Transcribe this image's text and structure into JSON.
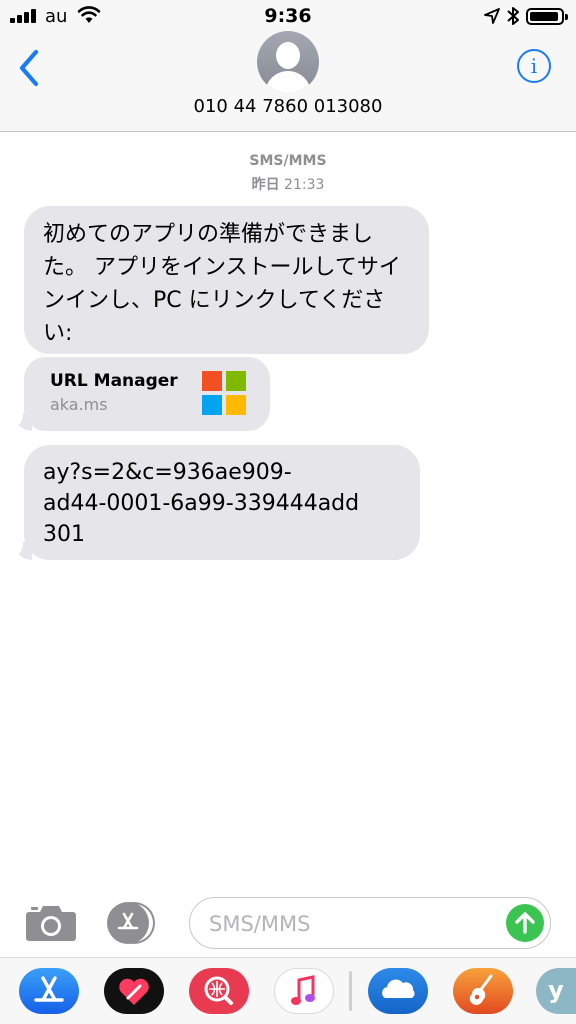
{
  "status_bar": {
    "carrier": "au",
    "time": "9:36"
  },
  "header": {
    "contact_name": "010 44 7860 013080",
    "info_label": "i"
  },
  "conversation": {
    "service": "SMS/MMS",
    "timestamp_day": "昨日",
    "timestamp_time": "21:33",
    "messages": [
      {
        "text": "初めてのアプリの準備ができました。 アプリをインストールしてサインインし、PC にリンクしてください:"
      },
      {
        "text": "ay?s=2&c=936ae909-\nad44-0001-6a99-339444add\n301"
      }
    ],
    "link_preview": {
      "title": "URL Manager",
      "domain": "aka.ms"
    }
  },
  "input_bar": {
    "placeholder": "SMS/MMS"
  },
  "app_drawer": {
    "apps": [
      {
        "icon": "app-store-icon"
      },
      {
        "icon": "digital-touch-icon"
      },
      {
        "icon": "image-search-icon"
      },
      {
        "icon": "music-icon"
      },
      {
        "icon": "onedrive-icon"
      },
      {
        "icon": "garageband-icon"
      },
      {
        "icon": "yahoo-icon",
        "label": "y"
      }
    ]
  },
  "colors": {
    "accent": "#1a7cf5",
    "bubble": "#e5e5ea",
    "send": "#3bc451",
    "meta": "#8e8e93"
  }
}
